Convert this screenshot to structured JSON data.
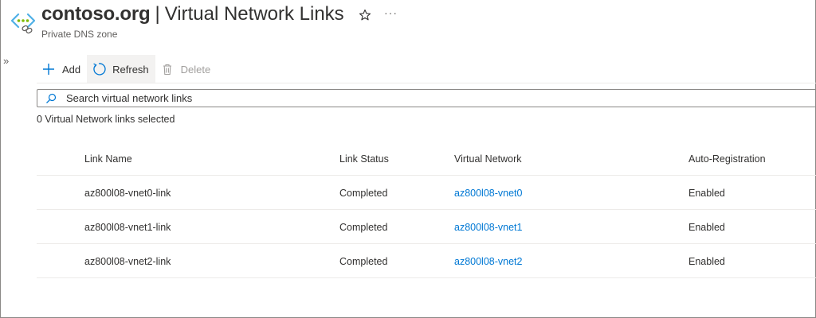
{
  "header": {
    "title_bold": "contoso.org",
    "title_separator": "|",
    "title_page": "Virtual Network Links",
    "subtitle": "Private DNS zone",
    "more_label": "···"
  },
  "sidebar": {
    "expand_label": "»"
  },
  "toolbar": {
    "add_label": "Add",
    "refresh_label": "Refresh",
    "delete_label": "Delete"
  },
  "search": {
    "placeholder": "Search virtual network links",
    "value": ""
  },
  "selection": {
    "text": "0 Virtual Network links selected"
  },
  "table": {
    "columns": [
      "Link Name",
      "Link Status",
      "Virtual Network",
      "Auto-Registration"
    ],
    "rows": [
      {
        "link_name": "az800l08-vnet0-link",
        "status": "Completed",
        "vnet": "az800l08-vnet0",
        "auto_registration": "Enabled"
      },
      {
        "link_name": "az800l08-vnet1-link",
        "status": "Completed",
        "vnet": "az800l08-vnet1",
        "auto_registration": "Enabled"
      },
      {
        "link_name": "az800l08-vnet2-link",
        "status": "Completed",
        "vnet": "az800l08-vnet2",
        "auto_registration": "Enabled"
      }
    ]
  },
  "colors": {
    "accent": "#0078d4",
    "text": "#323130",
    "muted": "#605e5c",
    "disabled": "#a19f9d",
    "divider": "#edebe9"
  },
  "icons": [
    "private-dns-zone-icon",
    "star-icon",
    "more-icon",
    "expand-icon",
    "add-icon",
    "refresh-icon",
    "delete-icon",
    "search-icon"
  ]
}
